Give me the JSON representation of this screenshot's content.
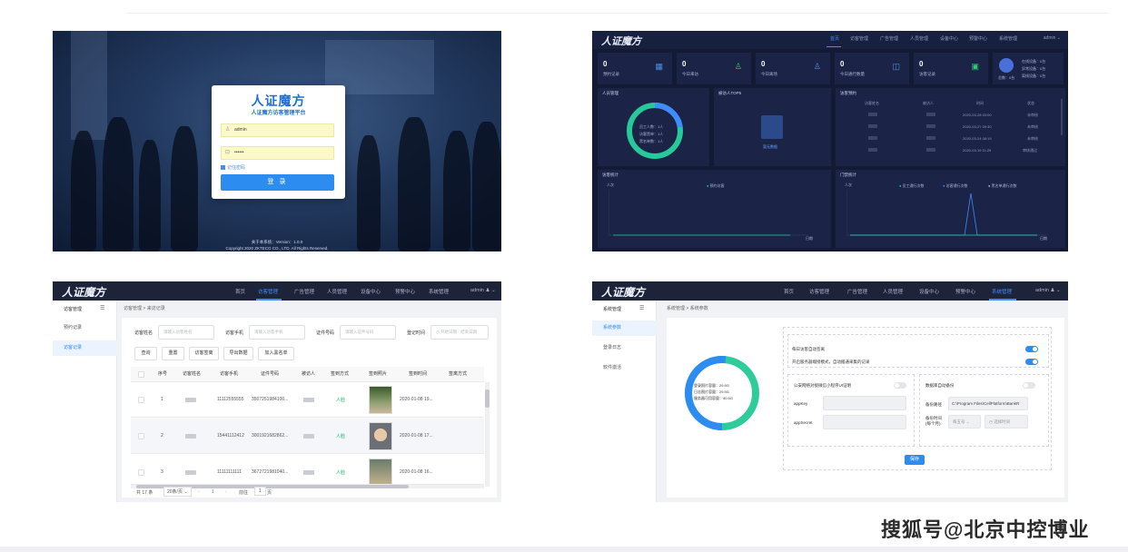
{
  "login": {
    "logo": "人证魔方",
    "subtitle": "人证魔方访客管理平台",
    "username": "admin",
    "password": "••••••",
    "remember": "记住密码",
    "submit": "登 录",
    "footer_version": "关于本系统：Version：1.0.0",
    "footer_copyright": "Copyright 2020 ZKTECO CO., LTD. All Rights Reserved."
  },
  "dashboard": {
    "logo": "人证魔方",
    "nav": [
      "首页",
      "访客管理",
      "广告管理",
      "人员管理",
      "设备中心",
      "预警中心",
      "系统管理"
    ],
    "active_nav": "首页",
    "admin": "admin",
    "stats": [
      {
        "value": "0",
        "label": "预约记录",
        "color": "#4a90e2"
      },
      {
        "value": "0",
        "label": "今日来访",
        "color": "#2ecc71"
      },
      {
        "value": "0",
        "label": "今日离场",
        "color": "#4a90e2"
      },
      {
        "value": "0",
        "label": "今日通行数量",
        "color": "#4a90e2"
      },
      {
        "value": "0",
        "label": "访客记录",
        "color": "#2ecc71"
      }
    ],
    "device_status": {
      "total": "总数：0台",
      "lines": [
        "在线设备：0台",
        "异常设备：0台",
        "离线设备：0台"
      ]
    },
    "personnel_title": "人员管理",
    "personnel_legend": [
      "员工人数：1人",
      "访客黑单：1人",
      "黑名单数：1人"
    ],
    "top5_title": "被访人TOP5",
    "top5_empty": "暂无数据",
    "booking_title": "访客预约",
    "booking_headers": [
      "访客姓名",
      "被访人",
      "时间",
      "状态"
    ],
    "booking_rows": [
      {
        "time": "2020-03-28 03:00",
        "status": "未审核"
      },
      {
        "time": "2020-03-27 09:30",
        "status": "未审核"
      },
      {
        "time": "2020-03-24 08:19",
        "status": "未审核"
      },
      {
        "time": "2020-03-19 11:25",
        "status": "审核通过"
      }
    ],
    "visitor_stats_title": "访客统计",
    "visitor_legend": "预约访客",
    "gate_stats_title": "门禁统计",
    "gate_legend": [
      "员工通行次数",
      "访客通行次数",
      "黑名单通行次数"
    ],
    "y_unit": "人次",
    "x_unit_left": "日期",
    "x_unit_right": "日期"
  },
  "visitors": {
    "logo": "人证魔方",
    "nav": [
      "首页",
      "访客管理",
      "广告管理",
      "人员管理",
      "设备中心",
      "预警中心",
      "系统管理"
    ],
    "active_nav": "访客管理",
    "admin": "admin",
    "side_header": "访客管理",
    "side_items": [
      "预约记录",
      "访客记录"
    ],
    "active_side": "访客记录",
    "crumb": "访客管理  >  来访记录",
    "filters": {
      "name_label": "访客姓名",
      "name_ph": "请输入访客姓名",
      "phone_label": "访客手机",
      "phone_ph": "请输入访客手机",
      "id_label": "证件号码",
      "id_ph": "请输入证件号码",
      "time_label": "登记时间",
      "time_ph": "开始日期 - 结束日期"
    },
    "buttons": [
      "查询",
      "重置",
      "访客签离",
      "导出数据",
      "加入黑名单"
    ],
    "headers": [
      "序号",
      "访客姓名",
      "访客手机",
      "证件号码",
      "被访人",
      "签到方式",
      "签到照片",
      "签到时间",
      "签离方式"
    ],
    "rows": [
      {
        "no": "1",
        "phone": "11112555555",
        "id": "3507251984100...",
        "method": "人脸",
        "time": "2020-01-08 19..."
      },
      {
        "no": "2",
        "phone": "15441112412",
        "id": "3001921682862...",
        "method": "人脸",
        "time": "2020-01-08 17..."
      },
      {
        "no": "3",
        "phone": "11111111111",
        "id": "3672721981040...",
        "method": "人脸",
        "time": "2020-01-08 16..."
      }
    ],
    "pager": {
      "total": "共 17 条",
      "size": "20条/页",
      "page": "1",
      "goto": "前往",
      "goto_page": "1",
      "page_unit": "页"
    }
  },
  "system": {
    "logo": "人证魔方",
    "nav": [
      "首页",
      "访客管理",
      "广告管理",
      "人员管理",
      "设备中心",
      "预警中心",
      "系统管理"
    ],
    "active_nav": "系统管理",
    "admin": "admin",
    "side_header": "系统管理",
    "side_items": [
      "系统参数",
      "登录日志",
      "软件激活"
    ],
    "active_side": "系统参数",
    "crumb": "系统管理  >  系统参数",
    "disk": [
      "登录照片容量：29.9G",
      "日志图片容量：29.9G",
      "服务器可用容量：40.5G"
    ],
    "toggle1": "每日访客自动签离",
    "toggle2": "开启服务器端接模式，自动搬通采集的记录",
    "app_title": "公安网络对接微信小程序UI证明",
    "app_key": "appKey",
    "app_secret": "appSecret",
    "backup_title": "数据库自动备份",
    "backup_path_label": "备份路径",
    "backup_path": "C:\\Program Files\\CellPlatform\\BankR",
    "backup_time_label": "备份时间\n(每个月)",
    "backup_sel1": "每五号",
    "backup_sel2": "选择时间",
    "save": "保存"
  },
  "watermark": "搜狐号@北京中控博业"
}
